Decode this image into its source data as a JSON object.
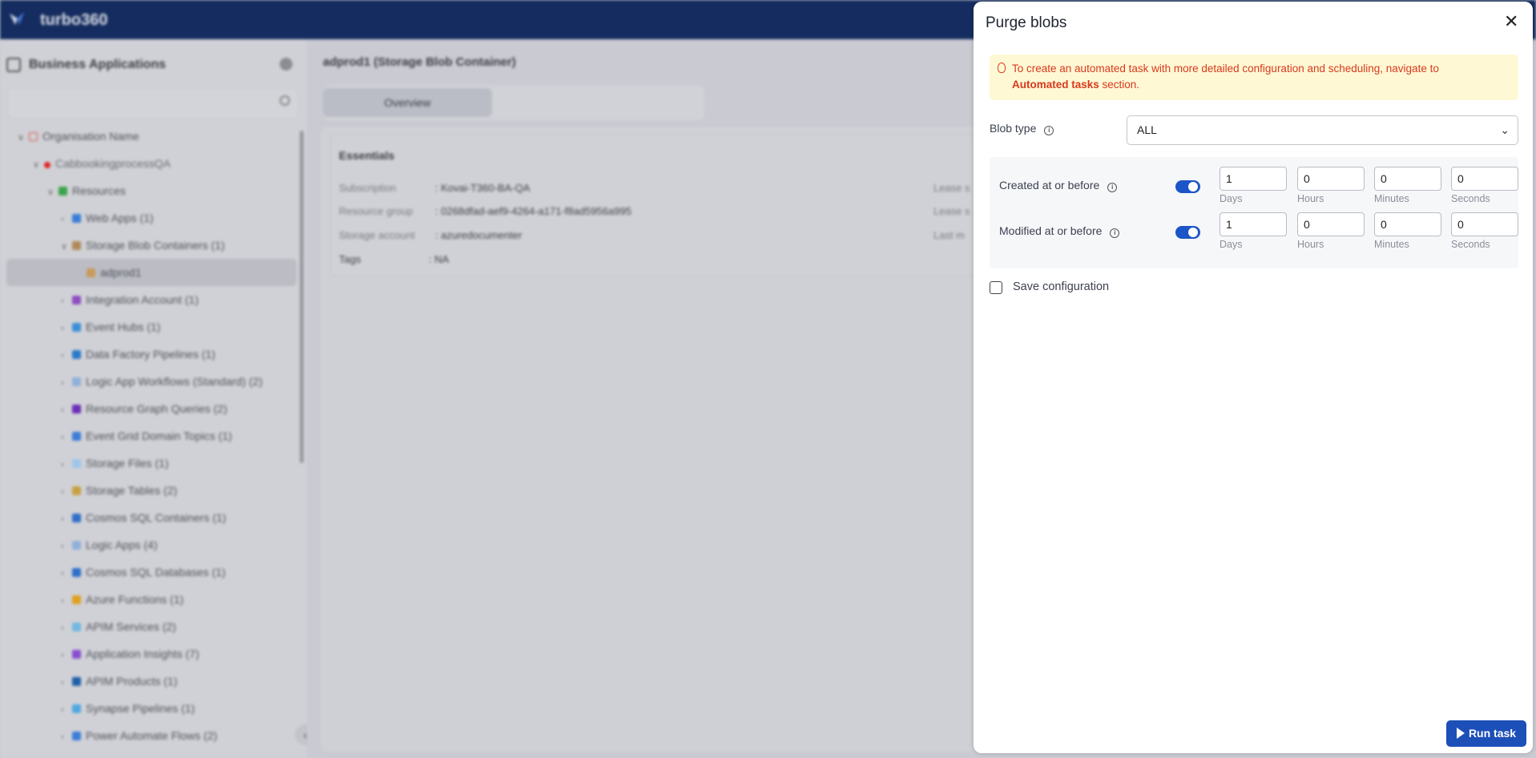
{
  "app": {
    "brand": "turbo360"
  },
  "sidebar": {
    "title": "Business Applications",
    "search_placeholder": "",
    "tree": [
      {
        "label": "Organisation Name",
        "level": 0,
        "expanded": true,
        "color": "#d9534f"
      },
      {
        "label": "CabbookingprocessQA",
        "level": 1,
        "expanded": true,
        "color": "#e02424"
      },
      {
        "label": "Resources",
        "level": 2,
        "expanded": true,
        "color": "#3aa34a"
      },
      {
        "label": "Web Apps (1)",
        "level": 3,
        "expanded": false,
        "color": "#3b7dd8"
      },
      {
        "label": "Storage Blob Containers (1)",
        "level": 3,
        "expanded": true,
        "color": "#b08a5a"
      },
      {
        "label": "adprod1",
        "level": 4,
        "selected": true,
        "color": "#c99a5a"
      },
      {
        "label": "Integration Account (1)",
        "level": 3,
        "expanded": false,
        "color": "#8c4fc0"
      },
      {
        "label": "Event Hubs (1)",
        "level": 3,
        "expanded": false,
        "color": "#3b8fd8"
      },
      {
        "label": "Data Factory Pipelines (1)",
        "level": 3,
        "expanded": false,
        "color": "#2a7ac8"
      },
      {
        "label": "Logic App Workflows (Standard) (2)",
        "level": 3,
        "expanded": false,
        "color": "#8fb0d8"
      },
      {
        "label": "Resource Graph Queries (2)",
        "level": 3,
        "expanded": false,
        "color": "#6b2fb8"
      },
      {
        "label": "Event Grid Domain Topics (1)",
        "level": 3,
        "expanded": false,
        "color": "#3b7dd8"
      },
      {
        "label": "Storage Files (1)",
        "level": 3,
        "expanded": false,
        "color": "#9fc5e8"
      },
      {
        "label": "Storage Tables (2)",
        "level": 3,
        "expanded": false,
        "color": "#c9a040"
      },
      {
        "label": "Cosmos SQL Containers (1)",
        "level": 3,
        "expanded": false,
        "color": "#2f6fc8"
      },
      {
        "label": "Logic Apps (4)",
        "level": 3,
        "expanded": false,
        "color": "#8fb0d8"
      },
      {
        "label": "Cosmos SQL Databases (1)",
        "level": 3,
        "expanded": false,
        "color": "#2f6fc8"
      },
      {
        "label": "Azure Functions (1)",
        "level": 3,
        "expanded": false,
        "color": "#e0a020"
      },
      {
        "label": "APIM Services (2)",
        "level": 3,
        "expanded": false,
        "color": "#70b8e0"
      },
      {
        "label": "Application Insights (7)",
        "level": 3,
        "expanded": false,
        "color": "#8a4fd0"
      },
      {
        "label": "APIM Products (1)",
        "level": 3,
        "expanded": false,
        "color": "#1f5fa8"
      },
      {
        "label": "Synapse Pipelines (1)",
        "level": 3,
        "expanded": false,
        "color": "#50a8e0"
      },
      {
        "label": "Power Automate Flows (2)",
        "level": 3,
        "expanded": false,
        "color": "#3b7dd8"
      }
    ]
  },
  "main": {
    "title": "adprod1 (Storage Blob Container)",
    "tabs": [
      {
        "label": "Overview",
        "active": true
      }
    ],
    "essentials": {
      "heading": "Essentials",
      "rows": [
        {
          "key": "Subscription",
          "value": "Kovai-T360-BA-QA"
        },
        {
          "key": "Resource group",
          "value": "0268dfad-aef9-4264-a171-f8ad5956a995"
        },
        {
          "key": "Storage account",
          "value": "azuredocumenter"
        },
        {
          "key": "Tags",
          "value": "NA"
        }
      ],
      "right_keys": [
        "Lease s",
        "Lease s",
        "Last m"
      ]
    }
  },
  "panel": {
    "title": "Purge blobs",
    "banner": {
      "text": "To create an automated task with more detailed configuration and scheduling, navigate to",
      "link": "Automated tasks",
      "suffix": " section.",
      "color": "#d9391e"
    },
    "blob_type": {
      "label": "Blob type",
      "value": "ALL"
    },
    "filters": [
      {
        "label": "Created at or before",
        "enabled": true,
        "days": "1",
        "hours": "0",
        "minutes": "0",
        "seconds": "0"
      },
      {
        "label": "Modified at or before",
        "enabled": true,
        "days": "1",
        "hours": "0",
        "minutes": "0",
        "seconds": "0"
      }
    ],
    "units": {
      "days": "Days",
      "hours": "Hours",
      "minutes": "Minutes",
      "seconds": "Seconds"
    },
    "save_config": {
      "label": "Save configuration",
      "checked": false
    },
    "run_label": "Run task",
    "accent": "#1d4fb8"
  }
}
